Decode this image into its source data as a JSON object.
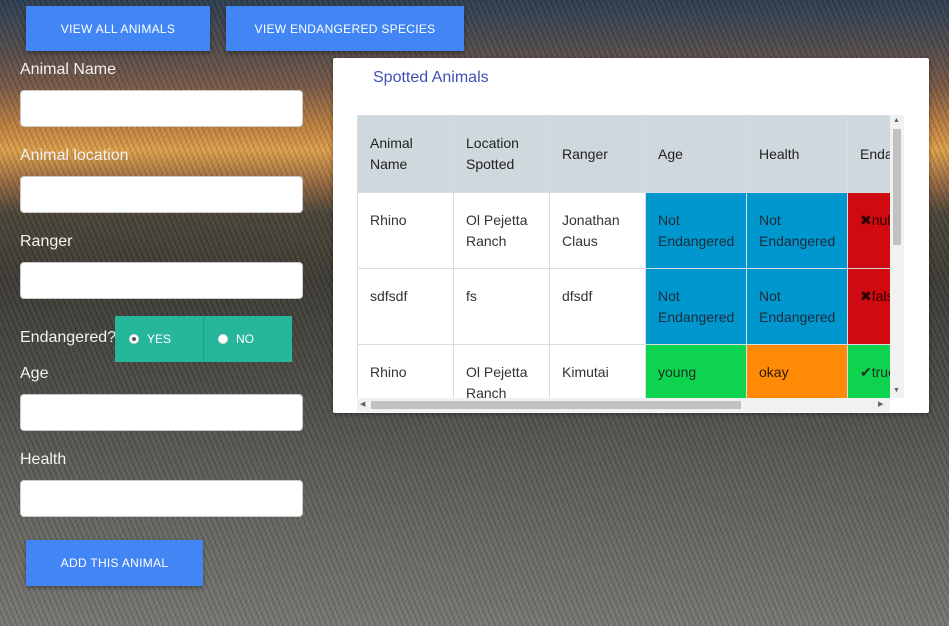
{
  "top_buttons": {
    "view_all": "VIEW ALL ANIMALS",
    "view_endangered": "VIEW ENDANGERED SPECIES"
  },
  "form": {
    "animal_name_label": "Animal Name",
    "animal_location_label": "Animal location",
    "ranger_label": "Ranger",
    "endangered_label": "Endangered?",
    "endangered_options": [
      "YES",
      "NO"
    ],
    "endangered_selected": "YES",
    "age_label": "Age",
    "health_label": "Health",
    "submit_label": "ADD THIS ANIMAL"
  },
  "panel": {
    "title": "Spotted Animals",
    "columns": [
      "Animal Name",
      "Location Spotted",
      "Ranger",
      "Age",
      "Health",
      "Endangered"
    ],
    "rows": [
      {
        "name": "Rhino",
        "location": "Ol Pejetta Ranch",
        "ranger": "Jonathan Claus",
        "age": "Not Endangered",
        "health": "Not Endangered",
        "endangered_icon": "x-icon",
        "endangered": "null"
      },
      {
        "name": "sdfsdf",
        "location": "fs",
        "ranger": "dfsdf",
        "age": "Not Endangered",
        "health": "Not Endangered",
        "endangered_icon": "x-icon",
        "endangered": "false"
      },
      {
        "name": "Rhino",
        "location": "Ol Pejetta Ranch",
        "ranger": "Kimutai",
        "age": "young",
        "health": "okay",
        "endangered_icon": "check-icon",
        "endangered": "true"
      }
    ]
  },
  "colors": {
    "button": "#4285f4",
    "radio_group": "#26b69c",
    "title": "#3f51b5",
    "not_endangered": "#0097cf",
    "false_null": "#cf0a10",
    "true": "#0ed34f",
    "okay": "#ff8a06",
    "young": "#0ed34f"
  }
}
